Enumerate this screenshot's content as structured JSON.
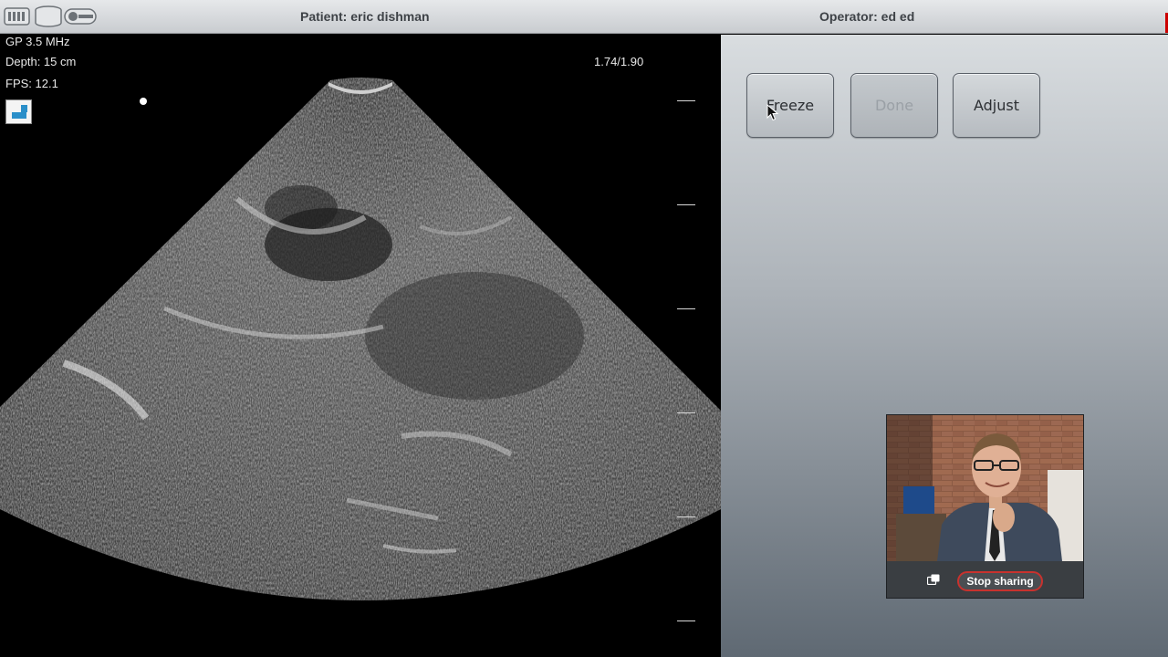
{
  "topbar": {
    "patient_label": "Patient: eric dishman",
    "operator_label": "Operator: ed ed",
    "icons": [
      "battery-icon",
      "database-icon",
      "probe-icon"
    ]
  },
  "ultrasound": {
    "frequency": "GP 3.5 MHz",
    "depth": "Depth: 15 cm",
    "fps": "FPS: 12.1",
    "ratio": "1.74/1.90"
  },
  "controls": {
    "freeze_label": "Freeze",
    "done_label": "Done",
    "adjust_label": "Adjust"
  },
  "video": {
    "stop_sharing_label": "Stop sharing"
  },
  "colors": {
    "accent_blue": "#2a8fc9",
    "stop_border": "#c8322e"
  }
}
